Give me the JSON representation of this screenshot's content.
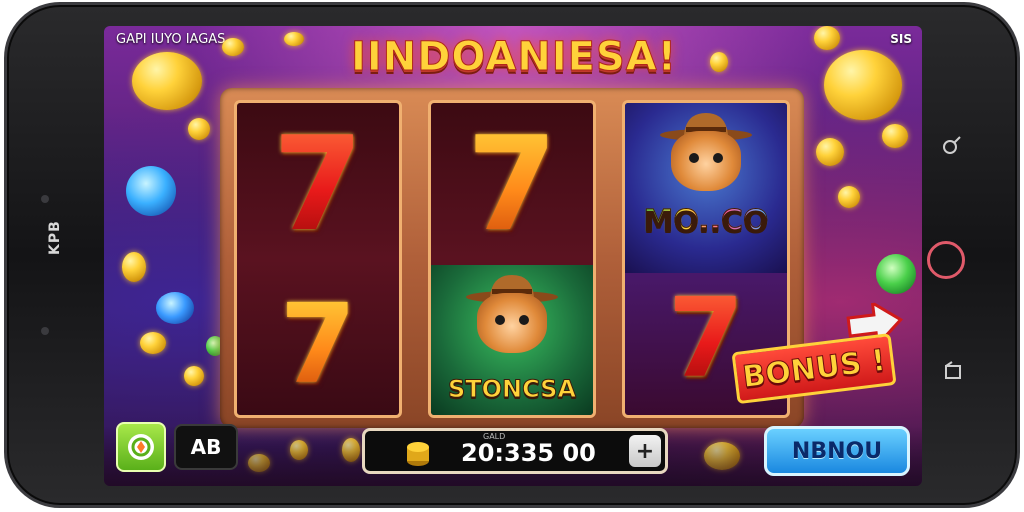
{
  "device": {
    "side_text": "KPB"
  },
  "game": {
    "title": "IINDOANIESA!",
    "top_left_text": "GAPI IUYO IAGAS",
    "top_right_text": "SIS"
  },
  "reels": [
    {
      "top_symbol": "7",
      "bottom_symbol": "7"
    },
    {
      "top_symbol": "7",
      "bottom_label": "STONCSA"
    },
    {
      "top_label": "MO..CO",
      "bottom_symbol": "7"
    }
  ],
  "bonus": {
    "label": "BONUS !"
  },
  "bottom_bar": {
    "ab_label": "AB",
    "balance_caption": "GALD",
    "balance_value": "20:335 00",
    "plus_label": "+",
    "spin_label": "NBNOU"
  },
  "colors": {
    "title": "#ffd23a",
    "seven_red": "#e81a1a",
    "seven_orange": "#ff8a1a",
    "spin_button": "#1a88e0",
    "bonus_badge": "#d01a1a"
  },
  "icons": [
    "search-icon",
    "home-button-icon",
    "back-icon",
    "coin-icon",
    "shield-icon",
    "arrow-icon"
  ]
}
